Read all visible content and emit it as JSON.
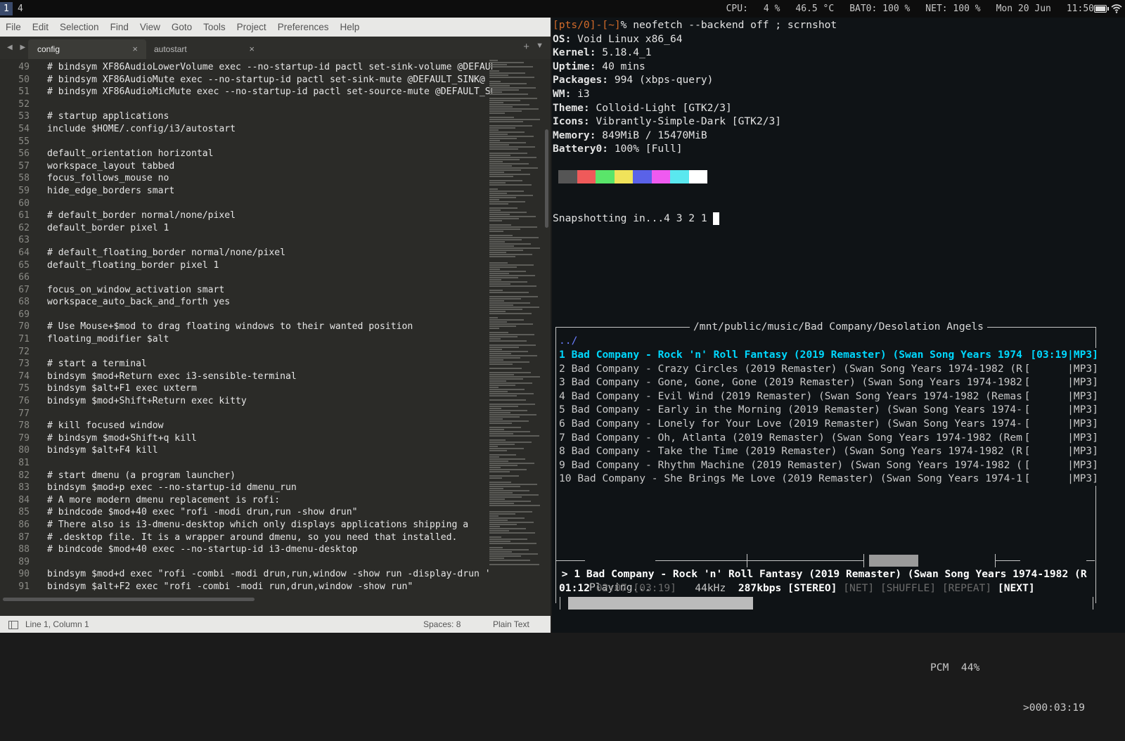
{
  "bar": {
    "workspaces": [
      "1",
      "4"
    ],
    "status": [
      "CPU:",
      "4 %",
      "46.5 °C",
      "BAT0: 100 %",
      "NET: 100 %",
      "Mon 20 Jun",
      "11:50"
    ]
  },
  "editor": {
    "menu": [
      "File",
      "Edit",
      "Selection",
      "Find",
      "View",
      "Goto",
      "Tools",
      "Project",
      "Preferences",
      "Help"
    ],
    "tabs": [
      {
        "label": "config",
        "close": "×"
      },
      {
        "label": "autostart",
        "close": "×"
      }
    ],
    "nav": "◀ ▶",
    "new_tab": "+",
    "tab_menu": "▼",
    "lines": [
      {
        "n": "49",
        "t": "# bindsym XF86AudioLowerVolume exec --no-startup-id pactl set-sink-volume @DEFAUL"
      },
      {
        "n": "50",
        "t": "# bindsym XF86AudioMute exec --no-startup-id pactl set-sink-mute @DEFAULT_SINK@"
      },
      {
        "n": "51",
        "t": "# bindsym XF86AudioMicMute exec --no-startup-id pactl set-source-mute @DEFAULT_SO"
      },
      {
        "n": "52",
        "t": ""
      },
      {
        "n": "53",
        "t": "# startup applications"
      },
      {
        "n": "54",
        "t": "include $HOME/.config/i3/autostart"
      },
      {
        "n": "55",
        "t": ""
      },
      {
        "n": "56",
        "t": "default_orientation horizontal"
      },
      {
        "n": "57",
        "t": "workspace_layout tabbed"
      },
      {
        "n": "58",
        "t": "focus_follows_mouse no"
      },
      {
        "n": "59",
        "t": "hide_edge_borders smart"
      },
      {
        "n": "60",
        "t": ""
      },
      {
        "n": "61",
        "t": "# default_border normal/none/pixel"
      },
      {
        "n": "62",
        "t": "default_border pixel 1"
      },
      {
        "n": "63",
        "t": ""
      },
      {
        "n": "64",
        "t": "# default_floating_border normal/none/pixel"
      },
      {
        "n": "65",
        "t": "default_floating_border pixel 1"
      },
      {
        "n": "66",
        "t": ""
      },
      {
        "n": "67",
        "t": "focus_on_window_activation smart"
      },
      {
        "n": "68",
        "t": "workspace_auto_back_and_forth yes"
      },
      {
        "n": "69",
        "t": ""
      },
      {
        "n": "70",
        "t": "# Use Mouse+$mod to drag floating windows to their wanted position"
      },
      {
        "n": "71",
        "t": "floating_modifier $alt"
      },
      {
        "n": "72",
        "t": ""
      },
      {
        "n": "73",
        "t": "# start a terminal"
      },
      {
        "n": "74",
        "t": "bindsym $mod+Return exec i3-sensible-terminal"
      },
      {
        "n": "75",
        "t": "bindsym $alt+F1 exec uxterm"
      },
      {
        "n": "76",
        "t": "bindsym $mod+Shift+Return exec kitty"
      },
      {
        "n": "77",
        "t": ""
      },
      {
        "n": "78",
        "t": "# kill focused window"
      },
      {
        "n": "79",
        "t": "# bindsym $mod+Shift+q kill"
      },
      {
        "n": "80",
        "t": "bindsym $alt+F4 kill"
      },
      {
        "n": "81",
        "t": ""
      },
      {
        "n": "82",
        "t": "# start dmenu (a program launcher)"
      },
      {
        "n": "83",
        "t": "bindsym $mod+p exec --no-startup-id dmenu_run"
      },
      {
        "n": "84",
        "t": "# A more modern dmenu replacement is rofi:"
      },
      {
        "n": "85",
        "t": "# bindcode $mod+40 exec \"rofi -modi drun,run -show drun\""
      },
      {
        "n": "86",
        "t": "# There also is i3-dmenu-desktop which only displays applications shipping a"
      },
      {
        "n": "87",
        "t": "# .desktop file. It is a wrapper around dmenu, so you need that installed."
      },
      {
        "n": "88",
        "t": "# bindcode $mod+40 exec --no-startup-id i3-dmenu-desktop"
      },
      {
        "n": "89",
        "t": ""
      },
      {
        "n": "90",
        "t": "bindsym $mod+d exec \"rofi -combi -modi drun,run,window -show run -display-drun '"
      },
      {
        "n": "91",
        "t": "bindsym $alt+F2 exec \"rofi -combi -modi run,drun,window -show run\""
      }
    ],
    "status_position": "Line 1, Column 1",
    "status_spaces": "Spaces: 8",
    "status_syntax": "Plain Text"
  },
  "terminal": {
    "prompt_user": "[pts/0]-[~]",
    "prompt_char": "% ",
    "command": "neofetch --backend off ; scrnshot",
    "info": [
      {
        "k": "OS:",
        "v": " Void Linux x86_64"
      },
      {
        "k": "Kernel:",
        "v": " 5.18.4_1"
      },
      {
        "k": "Uptime:",
        "v": " 40 mins"
      },
      {
        "k": "Packages:",
        "v": " 994 (xbps-query)"
      },
      {
        "k": "WM:",
        "v": " i3"
      },
      {
        "k": "Theme:",
        "v": " Colloid-Light [GTK2/3]"
      },
      {
        "k": "Icons:",
        "v": " Vibrantly-Simple-Dark [GTK2/3]"
      },
      {
        "k": "Memory:",
        "v": " 849MiB / 15470MiB"
      },
      {
        "k": "Battery0:",
        "v": " 100% [Full]"
      }
    ],
    "palette": [
      "#555555",
      "#ef5a5a",
      "#5ae56a",
      "#f0e35a",
      "#5a62e8",
      "#ef5af0",
      "#5ae8ef",
      "#ffffff"
    ],
    "snapshot": "Snapshotting in...4 3 2 1 "
  },
  "cmus": {
    "path": "/mnt/public/music/Bad Company/Desolation Angels",
    "updir": "../",
    "tracks": [
      {
        "line": "1 Bad Company - Rock 'n' Roll Fantasy (2019 Remaster) (Swan Song Years 1974",
        "tail": "[03:19|MP3]"
      },
      {
        "line": "2 Bad Company - Crazy Circles (2019 Remaster) (Swan Song Years 1974-1982 (R",
        "tail": "[      |MP3]"
      },
      {
        "line": "3 Bad Company - Gone, Gone, Gone (2019 Remaster) (Swan Song Years 1974-1982",
        "tail": "[      |MP3]"
      },
      {
        "line": "4 Bad Company - Evil Wind (2019 Remaster) (Swan Song Years 1974-1982 (Remas",
        "tail": "[      |MP3]"
      },
      {
        "line": "5 Bad Company - Early in the Morning (2019 Remaster) (Swan Song Years 1974-",
        "tail": "[      |MP3]"
      },
      {
        "line": "6 Bad Company - Lonely for Your Love (2019 Remaster) (Swan Song Years 1974-",
        "tail": "[      |MP3]"
      },
      {
        "line": "7 Bad Company - Oh, Atlanta (2019 Remaster) (Swan Song Years 1974-1982 (Rem",
        "tail": "[      |MP3]"
      },
      {
        "line": "8 Bad Company - Take the Time (2019 Remaster) (Swan Song Years 1974-1982 (R",
        "tail": "[      |MP3]"
      },
      {
        "line": "9 Bad Company - Rhythm Machine (2019 Remaster) (Swan Song Years 1974-1982 (",
        "tail": "[      |MP3]"
      },
      {
        "line": "10 Bad Company - She Brings Me Love (2019 Remaster) (Swan Song Years 1974-1",
        "tail": "[      |MP3]"
      }
    ],
    "playing": "Playing...",
    "volume": "PCM  44%",
    "remaining": ">000:03:19",
    "now_playing": " > 1 Bad Company - Rock 'n' Roll Fantasy (2019 Remaster) (Swan Song Years 1974-1982 (R",
    "elapsed": "01:12",
    "total": "02:07 [03:19]",
    "rate": "44kHz",
    "bitrate": "287kbps",
    "stereo": "[STEREO]",
    "flags_off": "[NET] [SHUFFLE] [REPEAT]",
    "next": "[NEXT]",
    "progress": 0.35
  }
}
